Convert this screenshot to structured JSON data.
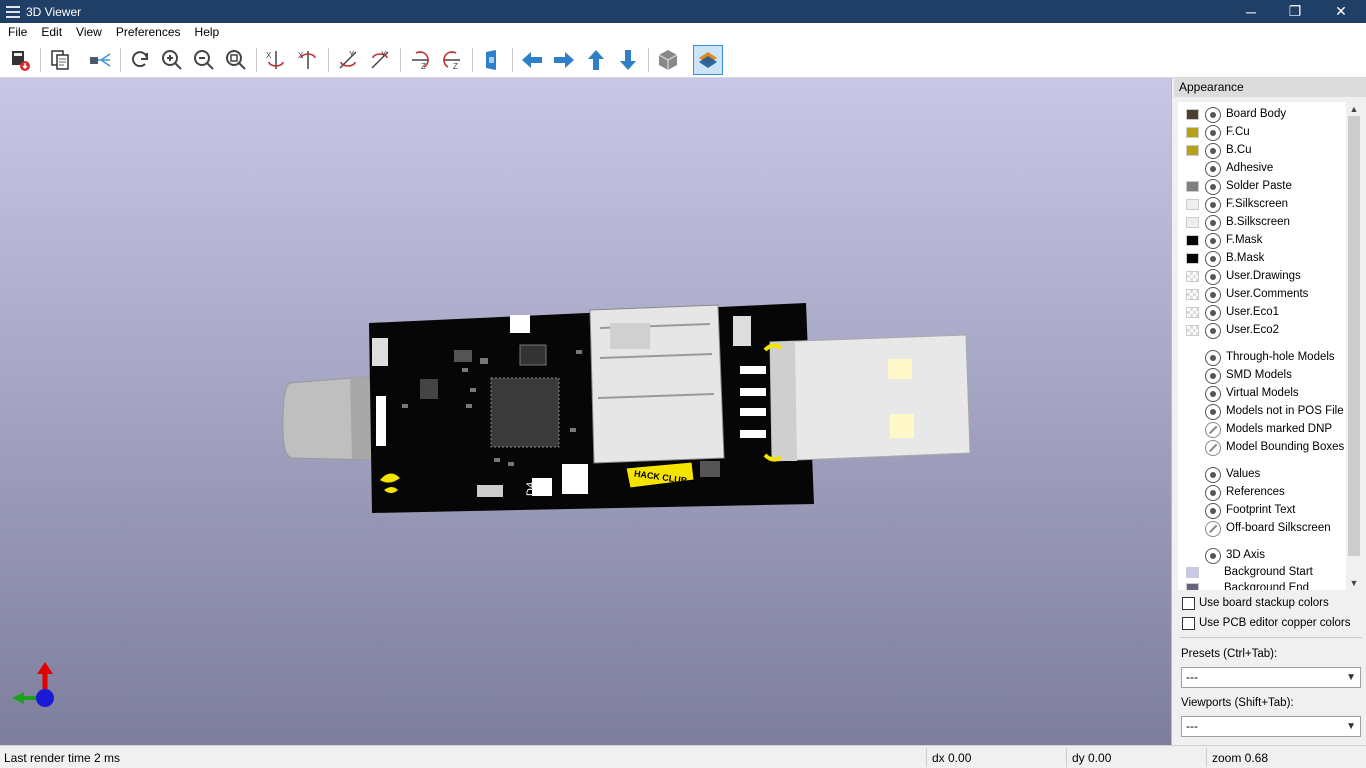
{
  "window": {
    "title": "3D Viewer",
    "minimize": "─",
    "maximize": "❐",
    "close": "✕"
  },
  "menu": [
    "File",
    "Edit",
    "View",
    "Preferences",
    "Help"
  ],
  "toolbar": {
    "icons": [
      "export-icon",
      "copy-icon",
      "raytrace-icon",
      "reload-icon",
      "zoom-in-icon",
      "zoom-out-icon",
      "zoom-fit-icon",
      "rotate-x-cw-icon",
      "rotate-x-ccw-icon",
      "rotate-y-cw-icon",
      "rotate-y-ccw-icon",
      "rotate-z-cw-icon",
      "rotate-z-ccw-icon",
      "flip-board-icon",
      "move-left-icon",
      "move-right-icon",
      "move-up-icon",
      "move-down-icon",
      "orthographic-icon",
      "layers-manager-icon"
    ]
  },
  "pcb": {
    "silk_text": "HACK CLUB",
    "ref_label": "D4"
  },
  "appearance": {
    "title": "Appearance",
    "layers": [
      {
        "name": "Board Body",
        "color": "#4a4030",
        "eye": "on"
      },
      {
        "name": "F.Cu",
        "color": "#b8a018",
        "eye": "on"
      },
      {
        "name": "B.Cu",
        "color": "#b8a018",
        "eye": "on"
      },
      {
        "name": "Adhesive",
        "color": "",
        "eye": "on"
      },
      {
        "name": "Solder Paste",
        "color": "#808080",
        "eye": "on"
      },
      {
        "name": "F.Silkscreen",
        "color": "#eeeeee",
        "eye": "on"
      },
      {
        "name": "B.Silkscreen",
        "color": "#eeeeee",
        "eye": "on"
      },
      {
        "name": "F.Mask",
        "color": "#050505",
        "eye": "on"
      },
      {
        "name": "B.Mask",
        "color": "#050505",
        "eye": "on"
      },
      {
        "name": "User.Drawings",
        "color": "checker",
        "eye": "on"
      },
      {
        "name": "User.Comments",
        "color": "checker",
        "eye": "on"
      },
      {
        "name": "User.Eco1",
        "color": "checker",
        "eye": "on"
      },
      {
        "name": "User.Eco2",
        "color": "checker",
        "eye": "on"
      }
    ],
    "models": [
      {
        "name": "Through-hole Models",
        "eye": "on"
      },
      {
        "name": "SMD Models",
        "eye": "on"
      },
      {
        "name": "Virtual Models",
        "eye": "on"
      },
      {
        "name": "Models not in POS File",
        "eye": "on"
      },
      {
        "name": "Models marked DNP",
        "eye": "off"
      },
      {
        "name": "Model Bounding Boxes",
        "eye": "off"
      }
    ],
    "texts": [
      {
        "name": "Values",
        "eye": "on"
      },
      {
        "name": "References",
        "eye": "on"
      },
      {
        "name": "Footprint Text",
        "eye": "on"
      },
      {
        "name": "Off-board Silkscreen",
        "eye": "off"
      }
    ],
    "misc": [
      {
        "name": "3D Axis",
        "eye": "on",
        "color": ""
      },
      {
        "name": "Background Start",
        "eye": "",
        "color": "#c8c8e6"
      },
      {
        "name": "Background End",
        "eye": "",
        "color": "#646480"
      }
    ],
    "use_stackup": "Use board stackup colors",
    "use_copper": "Use PCB editor copper colors",
    "presets_label": "Presets (Ctrl+Tab):",
    "presets_value": "---",
    "viewports_label": "Viewports (Shift+Tab):",
    "viewports_value": "---"
  },
  "status": {
    "render": "Last render time 2 ms",
    "dx": "dx 0.00",
    "dy": "dy 0.00",
    "zoom": "zoom 0.68"
  }
}
